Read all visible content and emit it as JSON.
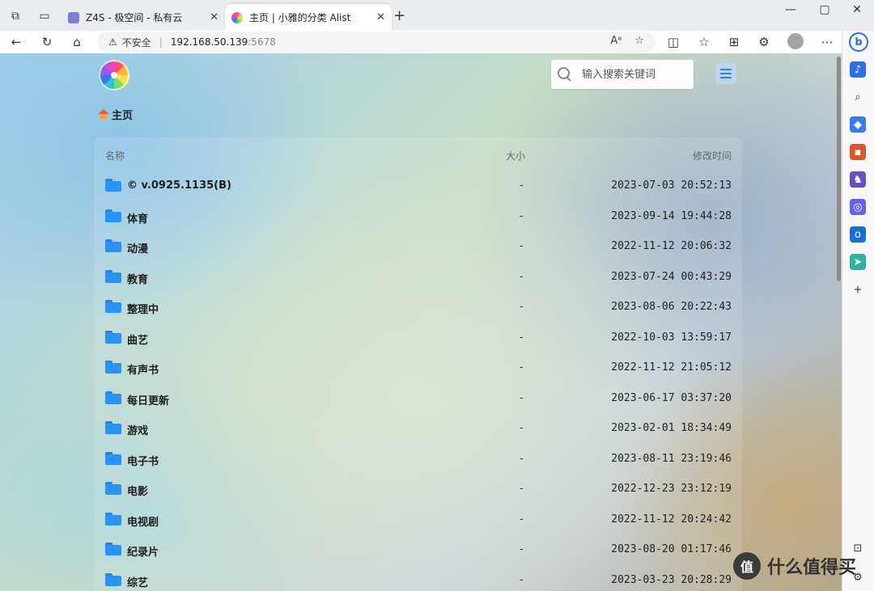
{
  "browser": {
    "tabs": [
      {
        "label": "Z4S - 极空间 - 私有云",
        "active": false
      },
      {
        "label": "主页 | 小雅的分类 Alist",
        "active": true
      }
    ],
    "new_tab_label": "+",
    "security_label": "不安全",
    "url_host": "192.168.50.139",
    "url_port": ":5678"
  },
  "page": {
    "search_placeholder": "输入搜索关键词",
    "breadcrumb_home": "主页",
    "columns": {
      "name": "名称",
      "size": "大小",
      "modified": "修改时间"
    },
    "rows": [
      {
        "name": "© v.0925.1135(B)",
        "size": "-",
        "modified": "2023-07-03 20:52:13"
      },
      {
        "name": "体育",
        "size": "-",
        "modified": "2023-09-14 19:44:28"
      },
      {
        "name": "动漫",
        "size": "-",
        "modified": "2022-11-12 20:06:32"
      },
      {
        "name": "教育",
        "size": "-",
        "modified": "2023-07-24 00:43:29"
      },
      {
        "name": "整理中",
        "size": "-",
        "modified": "2023-08-06 20:22:43"
      },
      {
        "name": "曲艺",
        "size": "-",
        "modified": "2022-10-03 13:59:17"
      },
      {
        "name": "有声书",
        "size": "-",
        "modified": "2022-11-12 21:05:12"
      },
      {
        "name": "每日更新",
        "size": "-",
        "modified": "2023-06-17 03:37:20"
      },
      {
        "name": "游戏",
        "size": "-",
        "modified": "2023-02-01 18:34:49"
      },
      {
        "name": "电子书",
        "size": "-",
        "modified": "2023-08-11 23:19:46"
      },
      {
        "name": "电影",
        "size": "-",
        "modified": "2022-12-23 23:12:19"
      },
      {
        "name": "电视剧",
        "size": "-",
        "modified": "2022-11-12 20:24:42"
      },
      {
        "name": "纪录片",
        "size": "-",
        "modified": "2023-08-20 01:17:46"
      },
      {
        "name": "综艺",
        "size": "-",
        "modified": "2023-03-23 20:28:29"
      }
    ]
  },
  "watermark": {
    "badge": "值",
    "text": "什么值得买"
  },
  "colors": {
    "folder": "#2b93f6",
    "accent": "#3a7fd1"
  }
}
